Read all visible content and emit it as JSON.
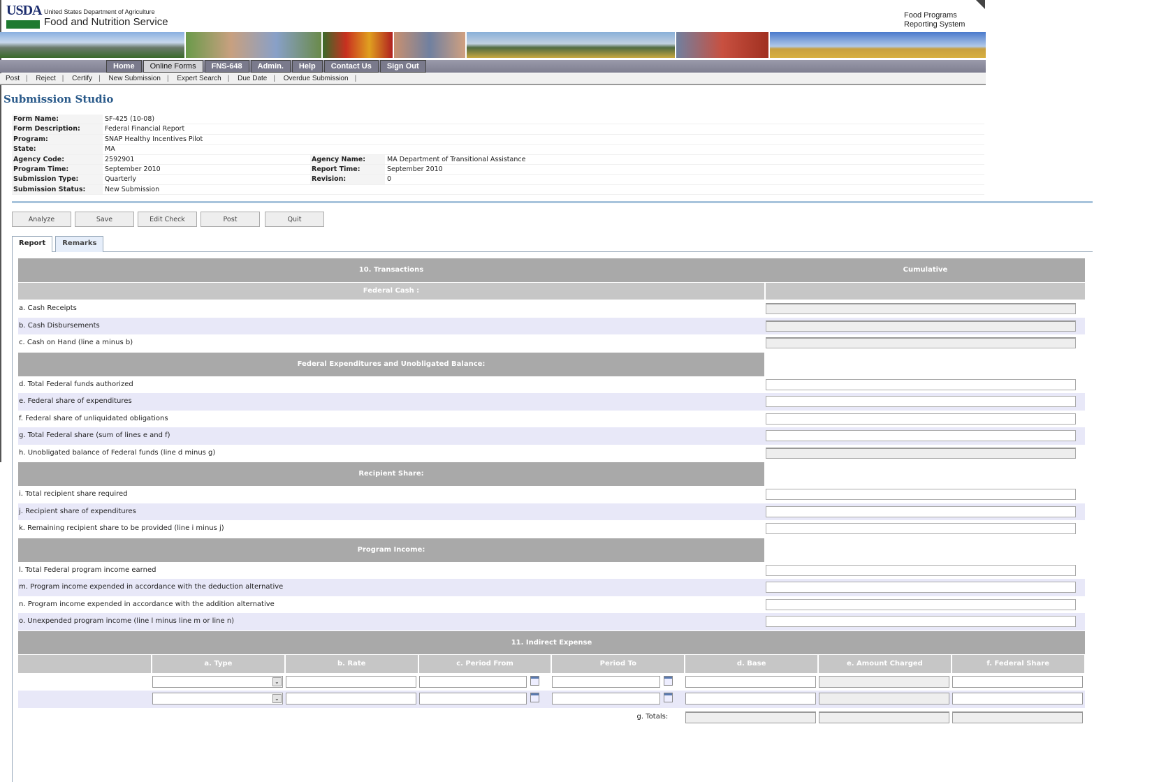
{
  "header": {
    "org_short": "USDA",
    "org_sub": "United States Department of Agriculture",
    "org_name": "Food and Nutrition Service",
    "system_line1": "Food Programs",
    "system_line2": "Reporting System"
  },
  "nav": [
    {
      "label": "Home"
    },
    {
      "label": "Online Forms",
      "active": true
    },
    {
      "label": "FNS-648"
    },
    {
      "label": "Admin."
    },
    {
      "label": "Help"
    },
    {
      "label": "Contact Us"
    },
    {
      "label": "Sign Out"
    }
  ],
  "subnav": [
    "Post",
    "Reject",
    "Certify",
    "New Submission",
    "Expert Search",
    "Due Date",
    "Overdue Submission"
  ],
  "page_title": "Submission Studio",
  "info": {
    "form_name": {
      "label": "Form Name:",
      "value": "SF-425 (10-08)"
    },
    "form_description": {
      "label": "Form Description:",
      "value": "Federal Financial Report"
    },
    "program": {
      "label": "Program:",
      "value": "SNAP Healthy Incentives Pilot"
    },
    "state": {
      "label": "State:",
      "value": "MA"
    },
    "agency_code": {
      "label": "Agency Code:",
      "value": "2592901"
    },
    "agency_name": {
      "label": "Agency Name:",
      "value": "MA Department of Transitional Assistance"
    },
    "program_time": {
      "label": "Program Time:",
      "value": "September 2010"
    },
    "report_time": {
      "label": "Report Time:",
      "value": "September 2010"
    },
    "submission_type": {
      "label": "Submission Type:",
      "value": "Quarterly"
    },
    "revision": {
      "label": "Revision:",
      "value": "0"
    },
    "submission_status": {
      "label": "Submission Status:",
      "value": "New Submission"
    }
  },
  "buttons": {
    "analyze": "Analyze",
    "save": "Save",
    "edit_check": "Edit Check",
    "post": "Post",
    "quit": "Quit"
  },
  "tabs": {
    "report": "Report",
    "remarks": "Remarks"
  },
  "table": {
    "title": "10. Transactions",
    "cumulative": "Cumulative",
    "rows": [
      {
        "type": "sub",
        "label": "Federal Cash :"
      },
      {
        "type": "line",
        "label": "a. Cash Receipts",
        "ro": true
      },
      {
        "type": "line",
        "label": "b. Cash Disbursements",
        "ro": true,
        "alt": true
      },
      {
        "type": "line",
        "label": "c. Cash on Hand (line a minus b)",
        "ro": true
      },
      {
        "type": "hdr",
        "label": "Federal Expenditures and Unobligated Balance:"
      },
      {
        "type": "line",
        "label": "d. Total Federal funds authorized"
      },
      {
        "type": "line",
        "label": "e. Federal share of expenditures",
        "alt": true
      },
      {
        "type": "line",
        "label": "f. Federal share of unliquidated obligations"
      },
      {
        "type": "line",
        "label": "g. Total Federal share (sum of lines e and f)",
        "alt": true
      },
      {
        "type": "line",
        "label": "h. Unobligated balance of Federal funds (line d minus g)",
        "ro": true
      },
      {
        "type": "hdr",
        "label": "Recipient Share:"
      },
      {
        "type": "line",
        "label": "i. Total recipient share required"
      },
      {
        "type": "line",
        "label": "j. Recipient share of expenditures",
        "alt": true
      },
      {
        "type": "line",
        "label": "k. Remaining recipient share to be provided (line i minus j)"
      },
      {
        "type": "hdr",
        "label": "Program Income:"
      },
      {
        "type": "line",
        "label": "l. Total Federal program income earned"
      },
      {
        "type": "line",
        "label": "m. Program income expended in accordance with the deduction alternative",
        "alt": true
      },
      {
        "type": "line",
        "label": "n. Program income expended in accordance with the addition alternative"
      },
      {
        "type": "line",
        "label": "o. Unexpended program income (line l minus line m or line n)",
        "alt": true
      }
    ]
  },
  "indirect": {
    "title": "11. Indirect Expense",
    "columns": [
      "a. Type",
      "b. Rate",
      "c. Period From",
      "Period To",
      "d. Base",
      "e. Amount Charged",
      "f. Federal Share"
    ],
    "totals_label": "g. Totals:"
  }
}
